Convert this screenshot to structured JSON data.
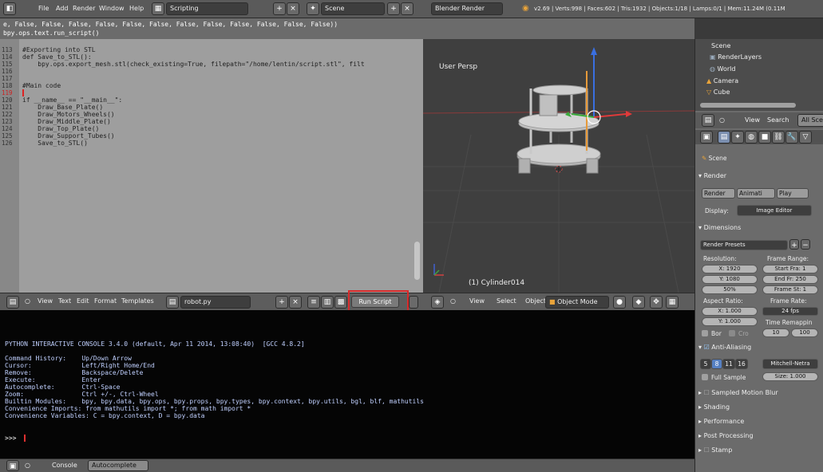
{
  "topbar": {
    "file": "File",
    "add": "Add",
    "render": "Render",
    "window": "Window",
    "help": "Help",
    "screen_layout": "Scripting",
    "scene": "Scene",
    "render_engine": "Blender Render",
    "stats": "v2.69 | Verts:998 | Faces:602 | Tris:1932 | Objects:1/18 | Lamps:0/1 | Mem:11.24M (0.11M"
  },
  "run_output": {
    "line1": "e, False, False, False, False, False, False, False, False, False, False, False, False))",
    "line2": "bpy.ops.text.run_script()"
  },
  "editor": {
    "lines": [
      {
        "num": "113",
        "text": "#Exporting into STL"
      },
      {
        "num": "114",
        "text": "def Save_to_STL():"
      },
      {
        "num": "115",
        "text": "    bpy.ops.export_mesh.stl(check_existing=True, filepath=\"/home/lentin/script.stl\", filt"
      },
      {
        "num": "116",
        "text": ""
      },
      {
        "num": "117",
        "text": ""
      },
      {
        "num": "118",
        "text": "#Main code"
      },
      {
        "num": "119",
        "text": ""
      },
      {
        "num": "120",
        "text": "if __name__ == \"__main__\":"
      },
      {
        "num": "121",
        "text": "    Draw_Base_Plate()"
      },
      {
        "num": "122",
        "text": "    Draw_Motors_Wheels()"
      },
      {
        "num": "123",
        "text": "    Draw_Middle_Plate()"
      },
      {
        "num": "124",
        "text": "    Draw_Top_Plate()"
      },
      {
        "num": "125",
        "text": "    Draw_Support_Tubes()"
      },
      {
        "num": "126",
        "text": "    Save_to_STL()"
      }
    ]
  },
  "editor_header": {
    "view": "View",
    "text": "Text",
    "edit": "Edit",
    "format": "Format",
    "templates": "Templates",
    "filename": "robot.py",
    "run_script": "Run Script"
  },
  "viewport": {
    "title": "User Persp",
    "object_label": "(1) Cylinder014"
  },
  "viewport_header": {
    "view": "View",
    "select": "Select",
    "object": "Object",
    "mode": "Object Mode"
  },
  "console": {
    "lines": [
      "PYTHON INTERACTIVE CONSOLE 3.4.0 (default, Apr 11 2014, 13:08:40)  [GCC 4.8.2]",
      "",
      "Command History:    Up/Down Arrow",
      "Cursor:             Left/Right Home/End",
      "Remove:             Backspace/Delete",
      "Execute:            Enter",
      "Autocomplete:       Ctrl-Space",
      "Zoom:               Ctrl +/-, Ctrl-Wheel",
      "Builtin Modules:    bpy, bpy.data, bpy.ops, bpy.props, bpy.types, bpy.context, bpy.utils, bgl, blf, mathutils",
      "Convenience Imports: from mathutils import *; from math import *",
      "Convenience Variables: C = bpy.context, D = bpy.data"
    ],
    "prompt": ">>> "
  },
  "console_footer": {
    "console": "Console",
    "autocomplete": "Autocomplete"
  },
  "outliner": {
    "scene": "Scene",
    "render_layers": "RenderLayers",
    "world": "World",
    "camera": "Camera",
    "cube": "Cube"
  },
  "properties": {
    "view": "View",
    "search": "Search",
    "all_scenes": "All Sce",
    "scene": "Scene",
    "render_section": "Render",
    "render_btn": "Render",
    "animation_btn": "Animati",
    "play_btn": "Play",
    "display_label": "Display:",
    "display_value": "Image Editor",
    "dimensions_section": "Dimensions",
    "render_presets": "Render Presets",
    "resolution_label": "Resolution:",
    "frame_range_label": "Frame Range:",
    "res_x": "X: 1920",
    "res_y": "Y: 1080",
    "res_pct": "50%",
    "start_frame": "Start Fra: 1",
    "end_frame": "End Fr: 250",
    "frame_step": "Frame St: 1",
    "aspect_label": "Aspect Ratio:",
    "frame_rate_label": "Frame Rate:",
    "asp_x": "X: 1.000",
    "asp_y": "Y: 1.000",
    "fps": "24 fps",
    "time_remap_label": "Time Remappin",
    "bor": "Bor",
    "cro": "Cro",
    "remap_old": "10",
    "remap_new": "100",
    "aa_section": "Anti-Aliasing",
    "aa_5": "5",
    "aa_8": "8",
    "aa_11": "11",
    "aa_16": "16",
    "aa_filter": "Mitchell-Netra",
    "full_sample": "Full Sample",
    "size": "Size: 1.000",
    "smb_section": "Sampled Motion Blur",
    "shading_section": "Shading",
    "performance_section": "Performance",
    "post_processing_section": "Post Processing",
    "stamp_section": "Stamp"
  }
}
